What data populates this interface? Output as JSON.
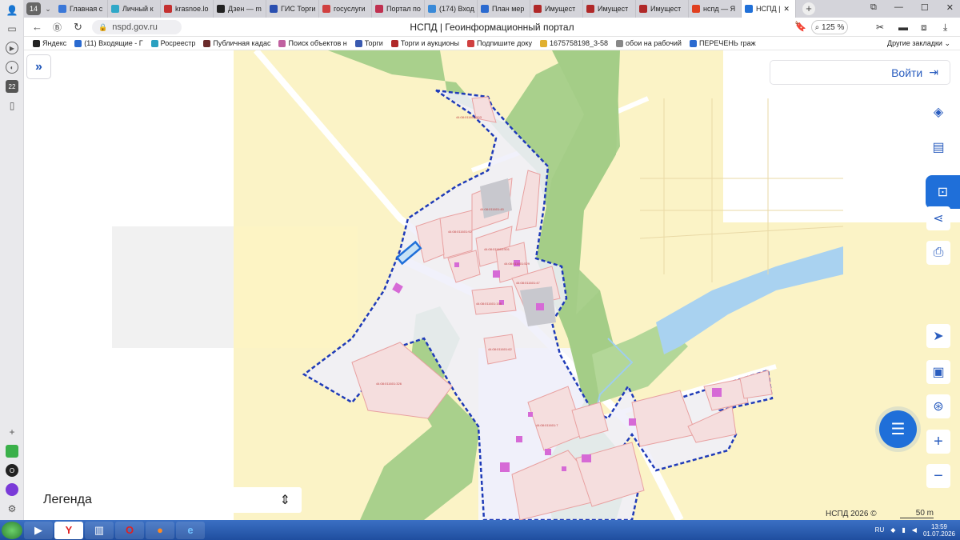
{
  "browser": {
    "tab_count": "14",
    "tabs": [
      {
        "label": "Главная с",
        "color": "#3a77d8"
      },
      {
        "label": "Личный к",
        "color": "#30a8c8"
      },
      {
        "label": "krasnoe.lo",
        "color": "#c43030"
      },
      {
        "label": "Дзен — m",
        "color": "#222222"
      },
      {
        "label": "ГИС Торги",
        "color": "#2a4fb0"
      },
      {
        "label": "госуслуги",
        "color": "#d04040"
      },
      {
        "label": "Портал по",
        "color": "#c03050"
      },
      {
        "label": "(174) Вход",
        "color": "#3a8ad8"
      },
      {
        "label": "План мер",
        "color": "#2a6ad0"
      },
      {
        "label": "Имущест",
        "color": "#b02828"
      },
      {
        "label": "Имущест",
        "color": "#b02828"
      },
      {
        "label": "Имущест",
        "color": "#b02828"
      },
      {
        "label": "нспд — Я",
        "color": "#e04020"
      },
      {
        "label": "НСПД |",
        "color": "#2070d8",
        "active": true
      }
    ],
    "url": "nspd.gov.ru",
    "page_title": "НСПД | Геоинформационный портал",
    "zoom": "125 %",
    "bookmarks": [
      {
        "label": "Яндекс",
        "color": "#222"
      },
      {
        "label": "(11) Входящие - Г",
        "color": "#2a6ad0"
      },
      {
        "label": "Росреестр",
        "color": "#2aa0c0"
      },
      {
        "label": "Публичная кадас",
        "color": "#6a2a2a"
      },
      {
        "label": "Поиск объектов н",
        "color": "#c060a0"
      },
      {
        "label": "Торги",
        "color": "#3a5ab0"
      },
      {
        "label": "Торги и аукционы",
        "color": "#b02828"
      },
      {
        "label": "Подпишите доку",
        "color": "#d04040"
      },
      {
        "label": "1675758198_3-58",
        "color": "#e0b030"
      },
      {
        "label": "обои на рабочий",
        "color": "#888"
      },
      {
        "label": "ПЕРЕЧЕНЬ граж",
        "color": "#2a6ad0"
      }
    ],
    "other_bookmarks": "Другие закладки"
  },
  "map": {
    "login_label": "Войти",
    "legend_label": "Легенда",
    "copyright": "НСПД 2026 ©",
    "scale_label": "50 m",
    "colors": {
      "field": "#fbf3c6",
      "forest": "#a9d08c",
      "water": "#a9d2f0",
      "boundary": "#1f3bb8",
      "parcel": "#f5dede",
      "building": "#d66ad6",
      "settlement": "#eeeefa"
    },
    "parcel_labels": [
      "44:08:011601:503",
      "44:08:011601:45",
      "44:08:011601:92",
      "44:08:011601:501",
      "44:08:011601:529",
      "44:08:011601:47",
      "44:08:011601:155",
      "44:08:011601:62",
      "44:08:011601:326",
      "44:08:011601:7"
    ]
  },
  "taskbar": {
    "lang": "RU",
    "time": "13:59",
    "date": "01.07.2026"
  }
}
